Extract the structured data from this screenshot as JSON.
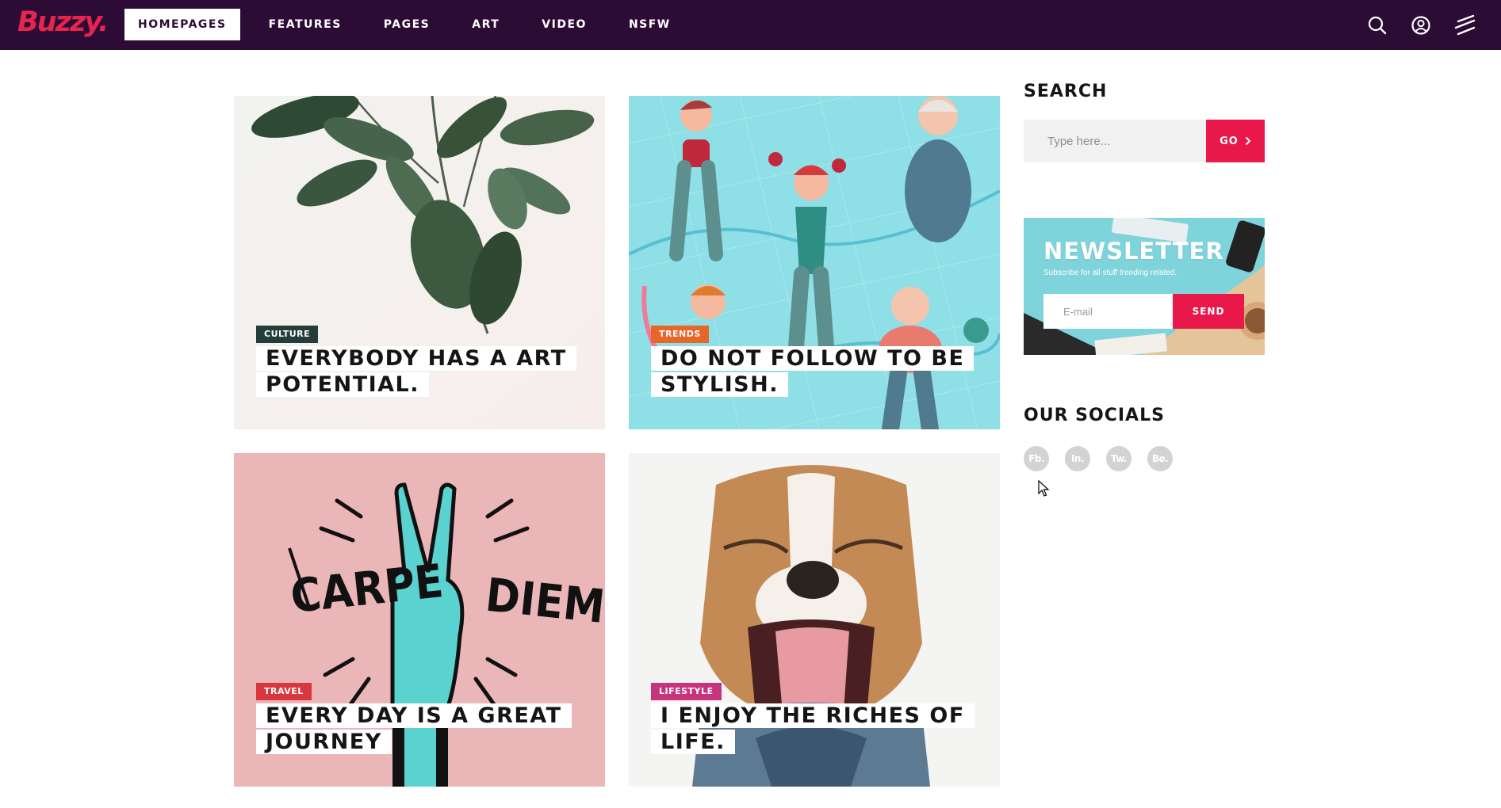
{
  "header": {
    "logo": "Buzzy.",
    "nav": [
      {
        "label": "HOMEPAGES",
        "active": true
      },
      {
        "label": "FEATURES",
        "active": false
      },
      {
        "label": "PAGES",
        "active": false
      },
      {
        "label": "ART",
        "active": false
      },
      {
        "label": "VIDEO",
        "active": false
      },
      {
        "label": "NSFW",
        "active": false
      }
    ],
    "icons": [
      "search-icon",
      "user-icon",
      "menu-icon"
    ],
    "background": "#2c0c34",
    "accent": "#e6244e"
  },
  "posts": [
    {
      "category": "CULTURE",
      "category_color": "#243c3a",
      "title": "EVERYBODY HAS A ART POTENTIAL.",
      "image": "plant-leaves"
    },
    {
      "category": "TRENDS",
      "category_color": "#e8662a",
      "title": "DO NOT FOLLOW TO BE STYLISH.",
      "image": "swimmers-illustration"
    },
    {
      "category": "TRAVEL",
      "category_color": "#d9363e",
      "title": "EVERY DAY IS A GREAT JOURNEY",
      "image": "carpe-diem-hand"
    },
    {
      "category": "LIFESTYLE",
      "category_color": "#c8337e",
      "title": "I ENJOY THE RICHES OF LIFE.",
      "image": "yawning-dog"
    }
  ],
  "sidebar": {
    "search": {
      "heading": "SEARCH",
      "placeholder": "Type here...",
      "button": "GO"
    },
    "newsletter": {
      "title": "NEWSLETTER",
      "subtitle": "Subscribe for all stuff trending related.",
      "placeholder": "E-mail",
      "button": "SEND"
    },
    "socials": {
      "heading": "OUR SOCIALS",
      "items": [
        "Fb.",
        "In.",
        "Tw.",
        "Be."
      ]
    }
  }
}
